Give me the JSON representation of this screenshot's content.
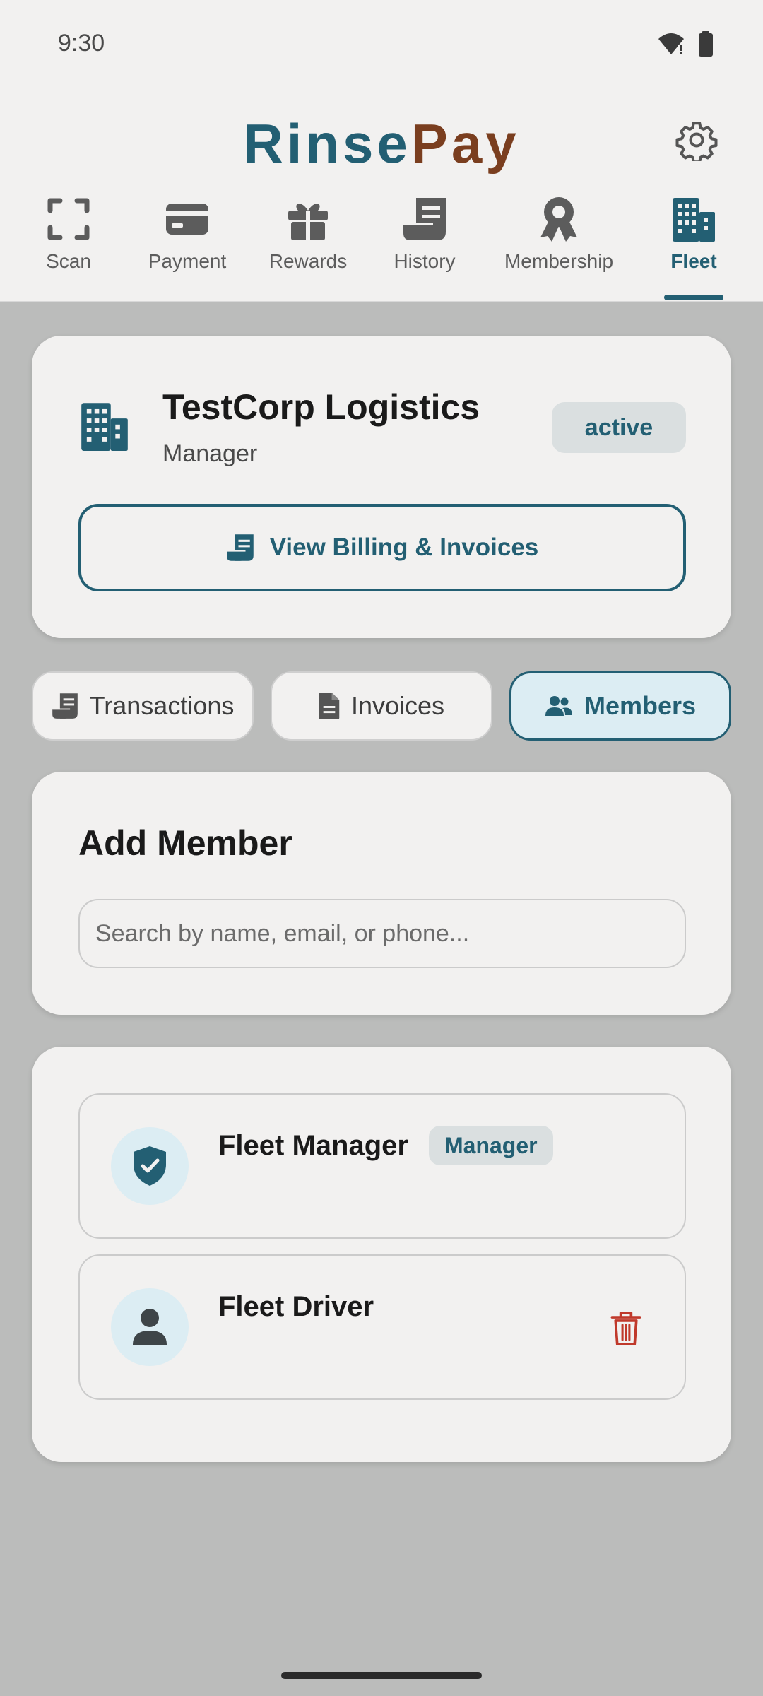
{
  "status_bar": {
    "time": "9:30"
  },
  "app": {
    "logo_part1": "Rinse",
    "logo_part2": "Pay"
  },
  "nav": {
    "items": [
      {
        "label": "Scan",
        "icon": "scan-icon"
      },
      {
        "label": "Payment",
        "icon": "credit-card-icon"
      },
      {
        "label": "Rewards",
        "icon": "gift-icon"
      },
      {
        "label": "History",
        "icon": "receipt-icon"
      },
      {
        "label": "Membership",
        "icon": "award-icon"
      },
      {
        "label": "Fleet",
        "icon": "building-icon"
      }
    ],
    "active": "Fleet"
  },
  "organization": {
    "name": "TestCorp Logistics",
    "role": "Manager",
    "status": "active",
    "billing_button": "View Billing & Invoices"
  },
  "tabs": [
    {
      "label": "Transactions",
      "icon": "receipt-icon"
    },
    {
      "label": "Invoices",
      "icon": "document-icon"
    },
    {
      "label": "Members",
      "icon": "users-icon"
    }
  ],
  "active_tab": "Members",
  "add_member": {
    "title": "Add Member",
    "search_placeholder": "Search by name, email, or phone..."
  },
  "members": [
    {
      "name": "Fleet Manager",
      "badge": "Manager",
      "icon": "shield-check-icon"
    },
    {
      "name": "Fleet Driver",
      "icon": "person-icon"
    }
  ],
  "colors": {
    "primary": "#235f73",
    "accent": "#7a3e1f",
    "danger": "#c0392b",
    "surface": "#f2f1f0",
    "backdrop": "#bbbcbb"
  }
}
